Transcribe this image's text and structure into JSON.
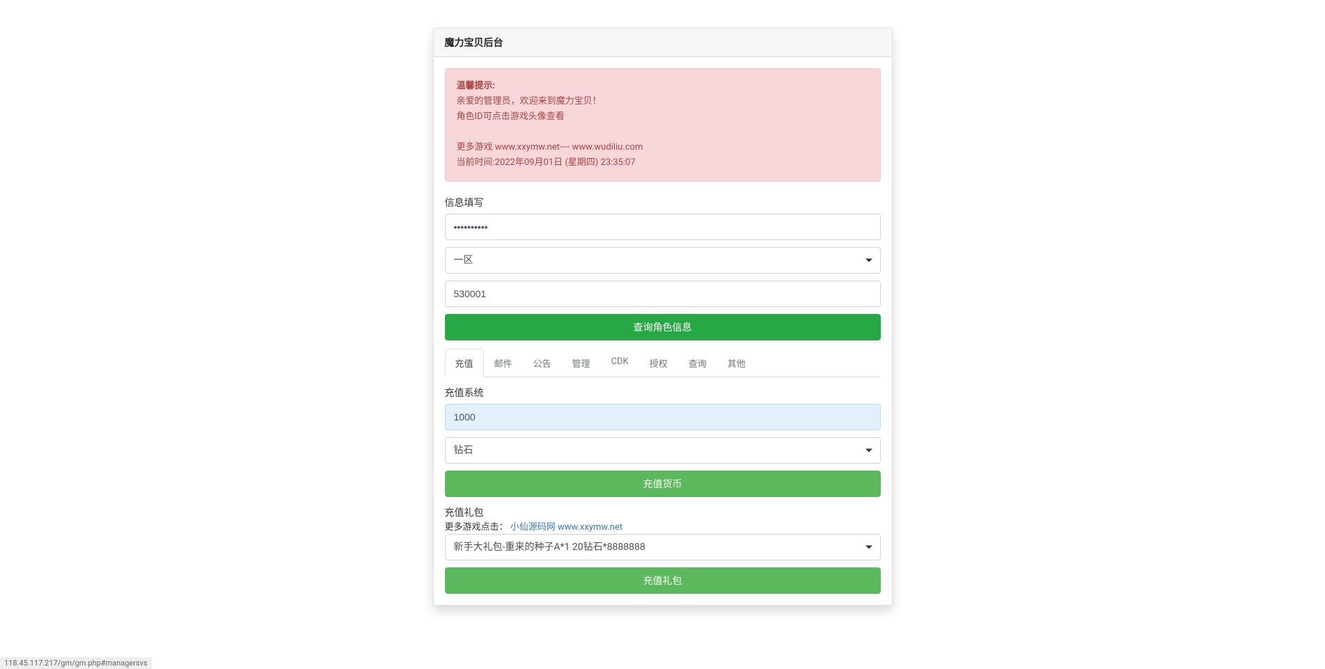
{
  "panel": {
    "title": "魔力宝贝后台"
  },
  "alert": {
    "title": "温馨提示:",
    "line1": "亲爱的管理员，欢迎来到魔力宝贝！",
    "line2": "角色ID可点击游戏头像查看",
    "line3": "更多游戏 www.xxymw.net---- www.wudiliu.com",
    "line4": "当前时间:2022年09月01日 (星期四) 23:35:07"
  },
  "info_form": {
    "label": "信息填写",
    "password_value": "••••••••••",
    "zone_selected": "一区",
    "role_id_value": "530001",
    "query_button": "查询角色信息"
  },
  "tabs": [
    {
      "label": "充值",
      "active": true
    },
    {
      "label": "邮件",
      "active": false
    },
    {
      "label": "公告",
      "active": false
    },
    {
      "label": "管理",
      "active": false
    },
    {
      "label": "CDK",
      "active": false
    },
    {
      "label": "授权",
      "active": false
    },
    {
      "label": "查询",
      "active": false
    },
    {
      "label": "其他",
      "active": false
    }
  ],
  "recharge": {
    "system_label": "充值系统",
    "amount_value": "1000",
    "currency_selected": "钻石",
    "currency_button": "充值货币",
    "gift_label": "充值礼包",
    "gift_subtext_prefix": "更多游戏点击：",
    "gift_subtext_link": "小仙源码网 www.xxymw.net",
    "gift_selected": "新手大礼包-重来的种子A*1 20钻石*8888888",
    "gift_button": "充值礼包"
  },
  "status_bar": "118.45.117.217/gm/gm.php#managersvs"
}
